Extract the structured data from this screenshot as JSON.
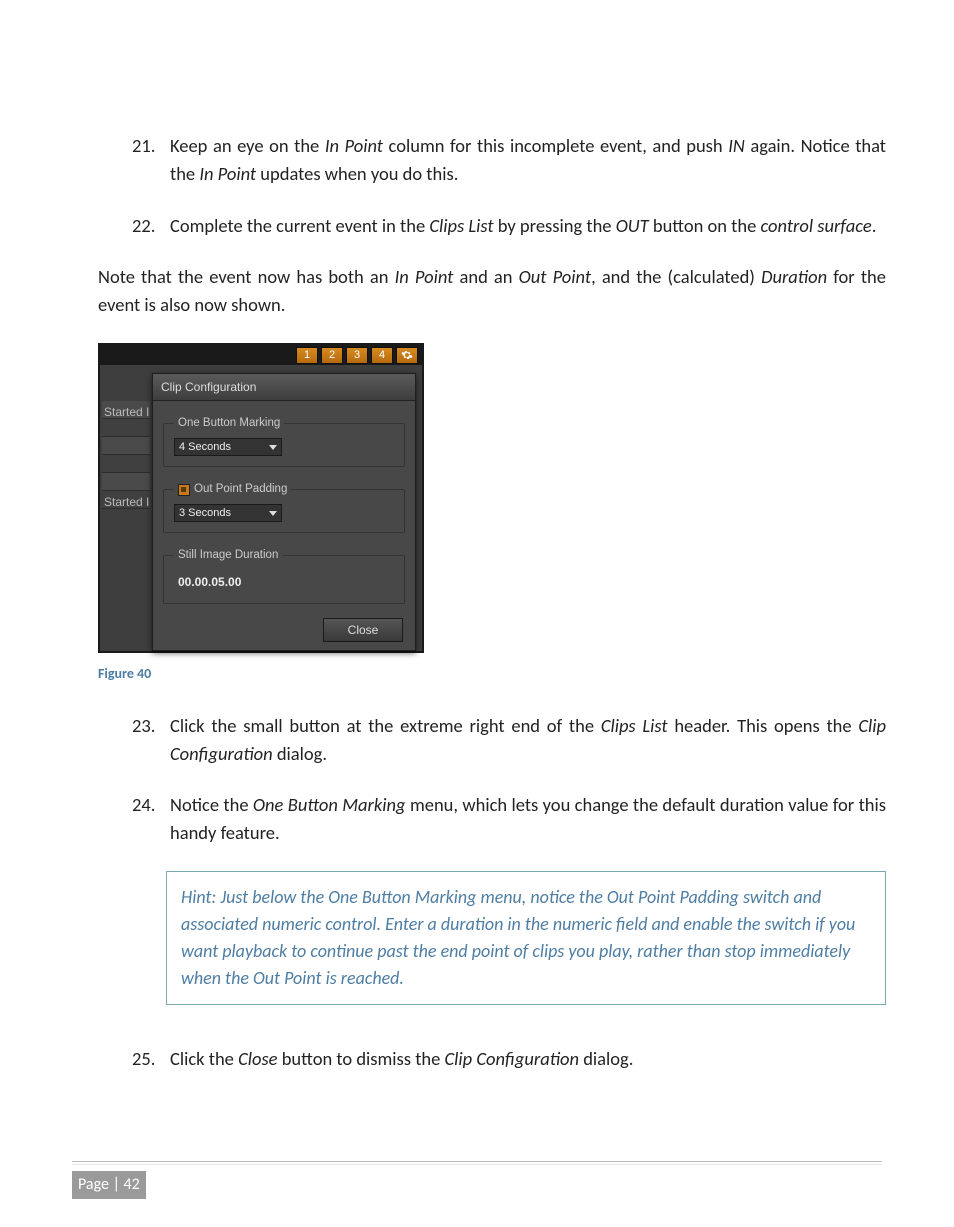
{
  "steps21": {
    "num": "21.",
    "text_a": "Keep an eye on the ",
    "i1": "In Point",
    "text_b": " column for this incomplete event, and push ",
    "i2": "IN",
    "text_c": " again. Notice that the ",
    "i3": "In Point",
    "text_d": " updates when you do this."
  },
  "steps22": {
    "num": "22.",
    "text_a": "Complete the current event in the ",
    "i1": "Clips List",
    "text_b": " by pressing the ",
    "i2": "OUT",
    "text_c": " button on the ",
    "i3": "control surface",
    "text_d": "."
  },
  "note": {
    "a": "Note that the event now has both an ",
    "i1": "In Point",
    "b": " and an ",
    "i2": "Out Point",
    "c": ", and the (calculated) ",
    "i3": "Duration",
    "d": " for the event is also now shown."
  },
  "shot": {
    "tabs": [
      "1",
      "2",
      "3",
      "4"
    ],
    "side_rows": [
      "Started I",
      "",
      "",
      "",
      "",
      "Started I"
    ],
    "dialog_title": "Clip Configuration",
    "group1_label": "One Button Marking",
    "group1_value": "4 Seconds",
    "group2_label": "Out Point Padding",
    "group2_value": "3 Seconds",
    "group3_label": "Still Image Duration",
    "group3_value": "00.00.05.00",
    "close": "Close"
  },
  "figure": "Figure 40",
  "steps23": {
    "num": "23.",
    "a": "Click the small button at the extreme right end of the ",
    "i1": "Clips List",
    "b": " header.  This opens the ",
    "i2": "Clip Configuration",
    "c": " dialog."
  },
  "steps24": {
    "num": "24.",
    "a": "Notice the ",
    "i1": "One Button Marking",
    "b": " menu, which lets you change the default duration value for this handy feature."
  },
  "hint": "Hint: Just below the One Button Marking menu, notice the Out Point Padding switch and associated numeric control.  Enter a duration in the numeric field and enable the switch if you want playback to continue past the end point of clips you play, rather than stop immediately when the Out Point is reached.",
  "steps25": {
    "num": "25.",
    "a": "Click the ",
    "i1": "Close",
    "b": " button to dismiss the ",
    "i2": "Clip Configuration",
    "c": " dialog."
  },
  "footer": "Page | 42"
}
